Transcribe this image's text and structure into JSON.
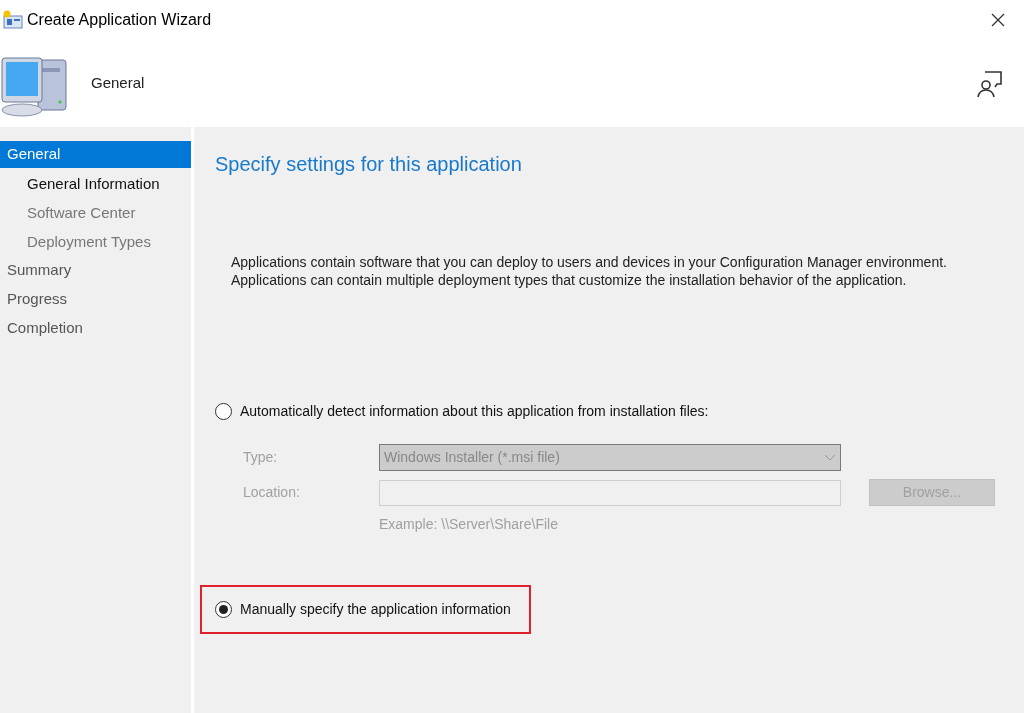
{
  "window": {
    "title": "Create Application Wizard"
  },
  "header": {
    "title": "General"
  },
  "sidebar": {
    "items": [
      {
        "label": "General",
        "selected": true,
        "children": [
          {
            "label": "General Information",
            "current": true
          },
          {
            "label": "Software Center",
            "current": false
          },
          {
            "label": "Deployment Types",
            "current": false
          }
        ]
      },
      {
        "label": "Summary",
        "selected": false
      },
      {
        "label": "Progress",
        "selected": false
      },
      {
        "label": "Completion",
        "selected": false
      }
    ]
  },
  "content": {
    "heading": "Specify settings for this application",
    "description": "Applications contain software that you can deploy to users and devices in your Configuration Manager environment. Applications can contain multiple deployment types that customize the installation behavior of the application.",
    "options": [
      {
        "label": "Automatically detect information about this application from installation files:",
        "selected": false,
        "highlighted": false,
        "fields": {
          "disabled": true,
          "type_label": "Type:",
          "type_value": "Windows Installer (*.msi file)",
          "location_label": "Location:",
          "browse": "Browse...",
          "example": "Example: \\\\Server\\Share\\File"
        }
      },
      {
        "label": "Manually specify the application information",
        "selected": true,
        "highlighted": true
      }
    ]
  }
}
